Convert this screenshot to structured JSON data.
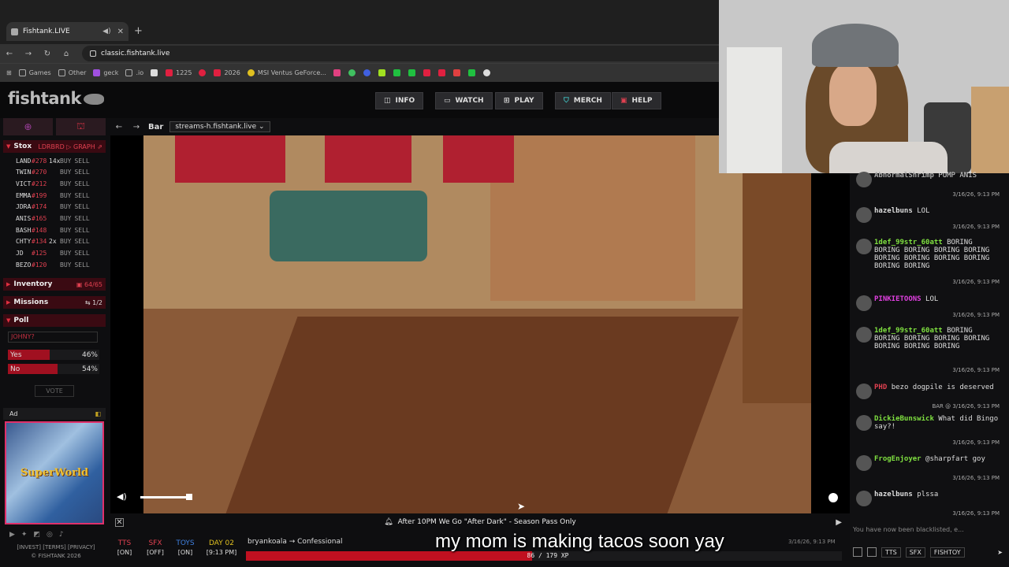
{
  "browser": {
    "tab_title": "Fishtank.LIVE",
    "url": "classic.fishtank.live",
    "bookmarks": [
      "Games",
      "Other",
      "geck",
      ".io",
      "1225",
      "2026",
      "MSI Ventus GeForce..."
    ]
  },
  "site": {
    "logo": "fishtank",
    "nav": [
      "INFO",
      "WATCH",
      "PLAY",
      "MERCH",
      "HELP"
    ]
  },
  "sidebar": {
    "stox": {
      "title": "Stox",
      "actions": "LDRBRD ▷ GRAPH ⇗",
      "buy": "BUY",
      "sell": "SELL",
      "rows": [
        {
          "ticker": "LAND",
          "price": "#278",
          "mult": "14x"
        },
        {
          "ticker": "TWIN",
          "price": "#270",
          "mult": ""
        },
        {
          "ticker": "VICT",
          "price": "#212",
          "mult": ""
        },
        {
          "ticker": "EMMA",
          "price": "#199",
          "mult": ""
        },
        {
          "ticker": "JDRA",
          "price": "#174",
          "mult": ""
        },
        {
          "ticker": "ANIS",
          "price": "#165",
          "mult": ""
        },
        {
          "ticker": "BASH",
          "price": "#148",
          "mult": ""
        },
        {
          "ticker": "CHTY",
          "price": "#134",
          "mult": "2x"
        },
        {
          "ticker": "JD",
          "price": "#125",
          "mult": ""
        },
        {
          "ticker": "BEZO",
          "price": "#120",
          "mult": ""
        }
      ]
    },
    "inventory": {
      "title": "Inventory",
      "count": "64/65"
    },
    "missions": {
      "title": "Missions",
      "count": "1/2"
    },
    "poll": {
      "title": "Poll",
      "question": "JOHNY?",
      "options": [
        {
          "label": "Yes",
          "pct": "46%",
          "value": 0.46
        },
        {
          "label": "No",
          "pct": "54%",
          "value": 0.54
        }
      ],
      "vote_label": "VOTE"
    },
    "ad": {
      "title": "Ad",
      "image_text": "SuperWorld"
    },
    "legal": {
      "line1": "[INVEST] [TERMS] [PRIVACY]",
      "line2": "© FISHTANK 2026"
    }
  },
  "viewer": {
    "room": "Bar",
    "stream": "streams-h.fishtank.live ⌄",
    "banner": "After 10PM We Go \"After Dark\" - Season Pass Only"
  },
  "status": {
    "tts": {
      "label": "TTS",
      "value": "[ON]"
    },
    "sfx": {
      "label": "SFX",
      "value": "[OFF]"
    },
    "toys": {
      "label": "TOYS",
      "value": "[ON]"
    },
    "day": {
      "label": "DAY 02",
      "value": "[9:13 PM]"
    },
    "cam": "bryankoala → Confessional",
    "xp_text": "86 / 179 XP",
    "xp_progress": 0.48,
    "overlay_time": "3/16/26, 9:13 PM"
  },
  "caption": "my mom is making tacos soon yay",
  "chat": {
    "messages": [
      {
        "user": "AbnormalShrimp",
        "text": "PUMP ANIS",
        "time": "3/16/26, 9:13 PM",
        "color": "#aaa"
      },
      {
        "user": "hazelbuns",
        "text": "LOL",
        "time": "3/16/26, 9:13 PM",
        "color": "#ddd"
      },
      {
        "user": "1def_99str_60att",
        "text": "BORING BORING BORING BORING BORING BORING BORING BORING BORING BORING BORING",
        "time": "3/16/26, 9:13 PM",
        "color": "#7fe040"
      },
      {
        "user": "PINKIETOONS",
        "text": "LOL",
        "time": "3/16/26, 9:13 PM",
        "color": "#e040e0"
      },
      {
        "user": "1def_99str_60att",
        "text": "BORING BORING BORING BORING BORING BORING BORING BORING",
        "time": "3/16/26, 9:13 PM",
        "color": "#7fe040"
      },
      {
        "user": "PHD",
        "text": "bezo dogpile is deserved",
        "time": "BAR @ 3/16/26, 9:13 PM",
        "color": "#e04050"
      },
      {
        "user": "DickieBunswick",
        "text": "What did Bingo say?!",
        "time": "3/16/26, 9:13 PM",
        "color": "#7fe040"
      },
      {
        "user": "FrogEnjoyer",
        "text": "@sharpfart goy",
        "time": "3/16/26, 9:13 PM",
        "color": "#7fe040"
      },
      {
        "user": "hazelbuns",
        "text": "plssa",
        "time": "3/16/26, 9:13 PM",
        "color": "#ddd"
      }
    ],
    "input_placeholder": "You have now been blacklisted, e...",
    "tools": [
      "TTS",
      "SFX",
      "FISHTOY"
    ]
  }
}
